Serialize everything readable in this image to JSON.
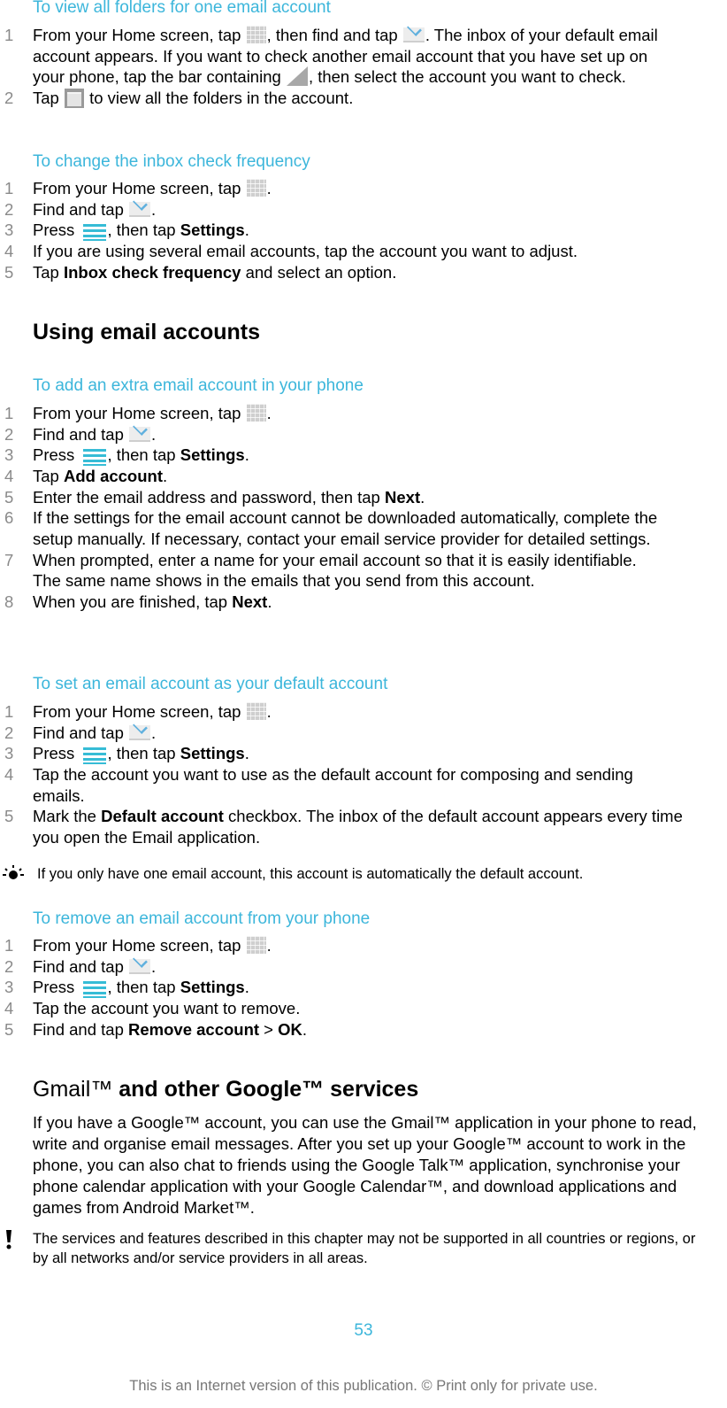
{
  "sections": {
    "view_folders": {
      "title": "To view all folders for one email account",
      "steps": [
        {
          "num": "1",
          "parts": [
            "From your Home screen, tap ",
            ", then find and tap ",
            ". The inbox of your default email account appears. If you want to check another email account that you have set up on your phone, tap the bar containing ",
            ", then select the account you want to check."
          ],
          "icons": [
            "apps-grid-icon",
            "email-icon",
            "dropdown-corner-icon"
          ]
        },
        {
          "num": "2",
          "parts": [
            "Tap ",
            " to view all the folders in the account."
          ],
          "icons": [
            "folder-icon"
          ]
        }
      ]
    },
    "check_frequency": {
      "title": "To change the inbox check frequency",
      "steps": [
        {
          "num": "1",
          "text_a": "From your Home screen, tap ",
          "text_b": "."
        },
        {
          "num": "2",
          "text_a": "Find and tap ",
          "text_b": "."
        },
        {
          "num": "3",
          "text_a": "Press ",
          "text_b": ", then tap ",
          "bold": "Settings",
          "text_c": "."
        },
        {
          "num": "4",
          "text": "If you are using several email accounts, tap the account you want to adjust."
        },
        {
          "num": "5",
          "text_a": "Tap ",
          "bold": "Inbox check frequency",
          "text_b": " and select an option."
        }
      ]
    },
    "using_heading": "Using email accounts",
    "add_account": {
      "title": "To add an extra email account in your phone",
      "steps": [
        {
          "num": "1",
          "text_a": "From your Home screen, tap ",
          "text_b": "."
        },
        {
          "num": "2",
          "text_a": "Find and tap ",
          "text_b": "."
        },
        {
          "num": "3",
          "text_a": "Press ",
          "text_b": ", then tap ",
          "bold": "Settings",
          "text_c": "."
        },
        {
          "num": "4",
          "text_a": "Tap ",
          "bold": "Add account",
          "text_b": "."
        },
        {
          "num": "5",
          "text_a": "Enter the email address and password, then tap ",
          "bold": "Next",
          "text_b": "."
        },
        {
          "num": "6",
          "text": "If the settings for the email account cannot be downloaded automatically, complete the setup manually. If necessary, contact your email service provider for detailed settings."
        },
        {
          "num": "7",
          "text": "When prompted, enter a name for your email account so that it is easily identifiable. The same name shows in the emails that you send from this account."
        },
        {
          "num": "8",
          "text_a": "When you are finished, tap ",
          "bold": "Next",
          "text_b": "."
        }
      ]
    },
    "default_account": {
      "title": "To set an email account as your default account",
      "steps": [
        {
          "num": "1",
          "text_a": "From your Home screen, tap ",
          "text_b": "."
        },
        {
          "num": "2",
          "text_a": "Find and tap ",
          "text_b": "."
        },
        {
          "num": "3",
          "text_a": "Press ",
          "text_b": ", then tap ",
          "bold": "Settings",
          "text_c": "."
        },
        {
          "num": "4",
          "text": "Tap the account you want to use as the default account for composing and sending emails."
        },
        {
          "num": "5",
          "text_a": "Mark the ",
          "bold": "Default account",
          "text_b": " checkbox. The inbox of the default account appears every time you open the Email application."
        }
      ],
      "tip": "If you only have one email account, this account is automatically the default account."
    },
    "remove_account": {
      "title": "To remove an email account from your phone",
      "steps": [
        {
          "num": "1",
          "text_a": "From your Home screen, tap ",
          "text_b": "."
        },
        {
          "num": "2",
          "text_a": "Find and tap ",
          "text_b": "."
        },
        {
          "num": "3",
          "text_a": "Press ",
          "text_b": ", then tap ",
          "bold": "Settings",
          "text_c": "."
        },
        {
          "num": "4",
          "text": "Tap the account you want to remove."
        },
        {
          "num": "5",
          "text_a": "Find and tap ",
          "bold": "Remove account",
          "text_b": " > ",
          "bold2": "OK",
          "text_c": "."
        }
      ]
    },
    "gmail": {
      "heading_light": "Gmail™",
      "heading_bold": " and other Google™ services",
      "body": "If you have a Google™ account, you can use the Gmail™ application in your phone to read, write and organise email messages. After you set up your Google™ account to work in the phone, you can also chat to friends using the Google Talk™ application, synchronise your phone calendar application with your Google Calendar™, and download applications and games from Android Market™.",
      "warning": "The services and features described in this chapter may not be supported in all countries or regions, or by all networks and/or service providers in all areas."
    }
  },
  "page_number": "53",
  "footer": "This is an Internet version of this publication. © Print only for private use.",
  "colors": {
    "accent": "#3cb6db",
    "step_number": "#8a8a8a",
    "text": "#000000"
  }
}
